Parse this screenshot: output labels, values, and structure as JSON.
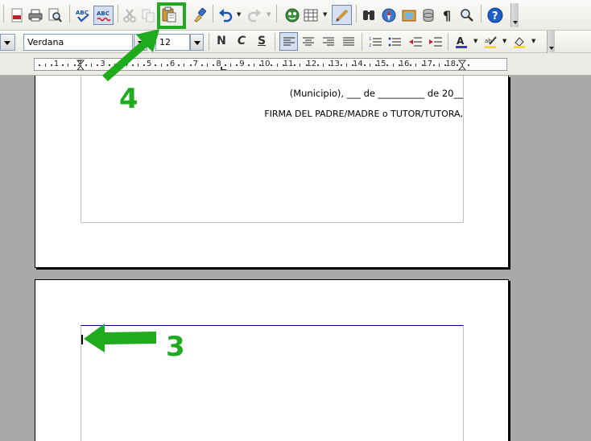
{
  "format_toolbar": {
    "font_name": "Verdana",
    "font_size": "12",
    "bold_label": "N",
    "italic_label": "C",
    "underline_label": "S"
  },
  "ruler": {
    "numbers": [
      "1",
      "2",
      "3",
      "4",
      "5",
      "6",
      "7",
      "8",
      "9",
      "10",
      "11",
      "12",
      "13",
      "14",
      "15",
      "16",
      "17",
      "18"
    ]
  },
  "document": {
    "page1": {
      "line1": "(Municipio), ___ de __________ de 20__",
      "line2": "FIRMA DEL PADRE/MADRE o TUTOR/TUTORA,"
    }
  },
  "annotations": {
    "step4": "4",
    "step3": "3",
    "color": "#1eab1e"
  }
}
